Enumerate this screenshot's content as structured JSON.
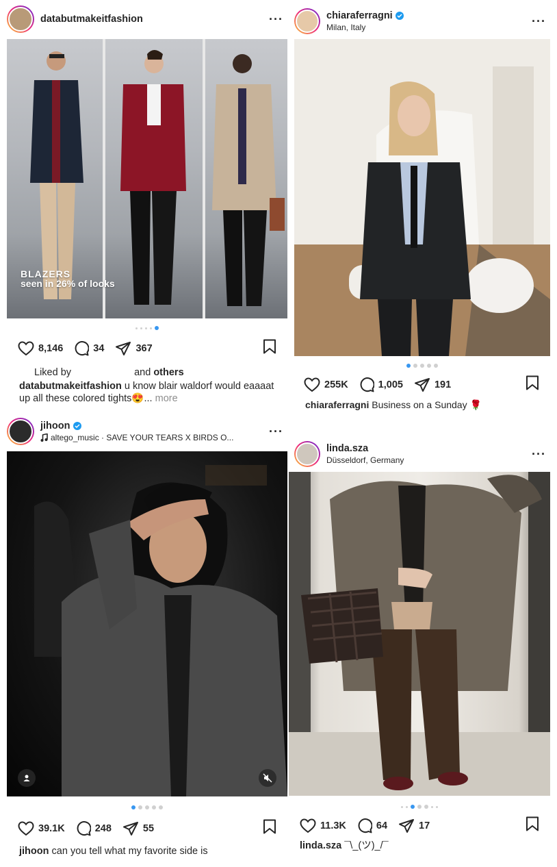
{
  "posts": [
    {
      "username": "databutmakeitfashion",
      "subtitle": "",
      "verified": false,
      "overlay_title": "BLAZERS",
      "overlay_subtitle": "seen in 26% of looks",
      "carousel": {
        "count": 5,
        "active": 5
      },
      "likes": "8,146",
      "comments": "34",
      "shares": "367",
      "liked_by_prefix": "Liked by",
      "liked_by_suffix": "and",
      "liked_by_others": "others",
      "caption_user": "databutmakeitfashion",
      "caption_text": "u know blair waldorf would eaaaat up all these colored tights😍...",
      "more_label": "more"
    },
    {
      "username": "chiaraferragni",
      "subtitle": "Milan, Italy",
      "verified": true,
      "carousel": {
        "count": 5,
        "active": 1
      },
      "likes": "255K",
      "comments": "1,005",
      "shares": "191",
      "caption_user": "chiaraferragni",
      "caption_text": "Business on a Sunday 🌹"
    },
    {
      "username": "jihoon",
      "subtitle": "altego_music · SAVE YOUR TEARS X BIRDS O...",
      "verified": true,
      "carousel": {
        "count": 5,
        "active": 1
      },
      "likes": "39.1K",
      "comments": "248",
      "shares": "55",
      "caption_user": "jihoon",
      "caption_text": "can you tell what my favorite side is"
    },
    {
      "username": "linda.sza",
      "subtitle": "Düsseldorf, Germany",
      "verified": false,
      "carousel": {
        "count": 7,
        "active": 3
      },
      "likes": "11.3K",
      "comments": "64",
      "shares": "17",
      "caption_user": "linda.sza",
      "caption_text": "¯\\_(ツ)_/¯"
    }
  ],
  "colors": {
    "accent": "#3897f0",
    "verified": "#1d9bf0",
    "text": "#262626",
    "muted": "#8e8e8e"
  },
  "icons": [
    "heart-icon",
    "comment-icon",
    "share-icon",
    "bookmark-icon",
    "more-icon",
    "music-note-icon",
    "user-tag-icon",
    "mute-icon",
    "verified-badge-icon"
  ]
}
